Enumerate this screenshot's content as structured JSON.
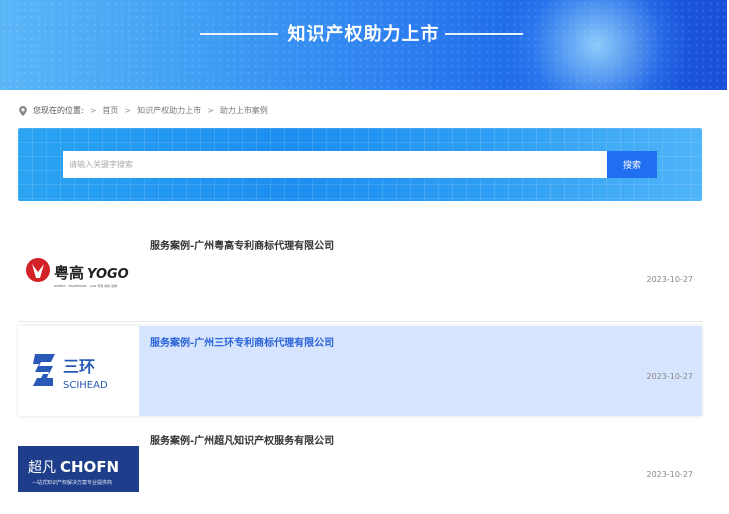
{
  "banner": {
    "title": "知识产权助力上市"
  },
  "breadcrumb": {
    "label": "您现在的位置:",
    "items": [
      "首页",
      "知识产权助力上市",
      "助力上市案例"
    ],
    "separator": ">"
  },
  "search": {
    "placeholder": "请输入关键字搜索",
    "button_label": "搜索"
  },
  "cases": [
    {
      "title": "服务案例-广州粤高专利商标代理有限公司",
      "date": "2023-10-27",
      "logo_text": "粤高",
      "logo_brand": "YOGO",
      "logo_sub": "PATENT · TRADEMARK · LAW  专利·商标·法律"
    },
    {
      "title": "服务案例-广州三环专利商标代理有限公司",
      "date": "2023-10-27",
      "logo_text": "三环",
      "logo_brand": "SCIHEAD"
    },
    {
      "title": "服务案例-广州超凡知识产权服务有限公司",
      "date": "2023-10-27",
      "logo_text": "超凡",
      "logo_brand": "CHOFN",
      "logo_sub": "—站式知识产权解决方案专业提供商"
    }
  ],
  "colors": {
    "accent": "#1f6ff0",
    "active_bg": "#d6e4fd",
    "active_title": "#2a63d8"
  }
}
